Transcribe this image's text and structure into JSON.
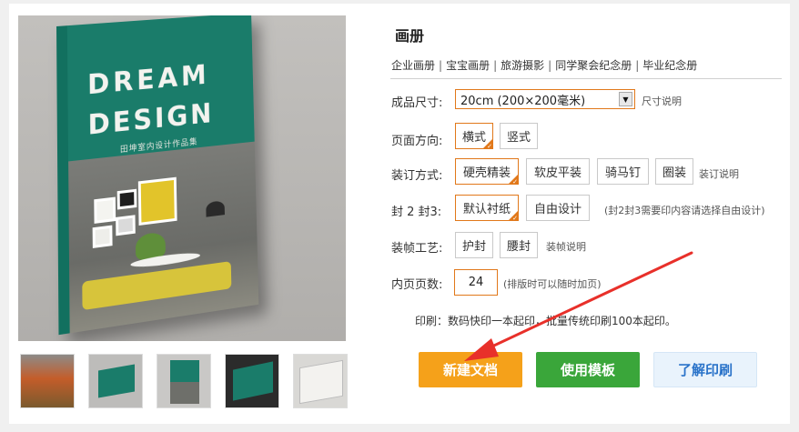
{
  "preview": {
    "cover_line1": "DREAM",
    "cover_line2": "DESIGN",
    "cover_subtitle": "田坤室内设计作品集"
  },
  "product": {
    "title": "画册",
    "categories": [
      "企业画册",
      "宝宝画册",
      "旅游摄影",
      "同学聚会纪念册",
      "毕业纪念册"
    ]
  },
  "form": {
    "size": {
      "label": "成品尺寸:",
      "value": "20cm (200×200毫米)",
      "note": "尺寸说明"
    },
    "orientation": {
      "label": "页面方向:",
      "options": [
        "横式",
        "竖式"
      ],
      "selected": "横式"
    },
    "binding": {
      "label": "装订方式:",
      "options": [
        "硬壳精装",
        "软皮平装",
        "骑马钉",
        "圈装"
      ],
      "selected": "硬壳精装",
      "note": "装订说明"
    },
    "cover23": {
      "label": "封 2 封3:",
      "options": [
        "默认衬纸",
        "自由设计"
      ],
      "selected": "默认衬纸",
      "note": "(封2封3需要印内容请选择自由设计)"
    },
    "finish": {
      "label": "装帧工艺:",
      "options": [
        "护封",
        "腰封"
      ],
      "note": "装帧说明"
    },
    "pages": {
      "label": "内页页数:",
      "value": "24",
      "note": "(排版时可以随时加页)"
    },
    "print_note": "印刷：数码快印一本起印，批量传统印刷100本起印。"
  },
  "actions": {
    "new_doc": "新建文档",
    "use_template": "使用模板",
    "learn_print": "了解印刷"
  },
  "colors": {
    "accent_orange": "#e1781a",
    "button_orange": "#f5a11a",
    "button_green": "#3aa63a",
    "button_light": "#e9f3fc",
    "arrow_red": "#e8302a"
  }
}
